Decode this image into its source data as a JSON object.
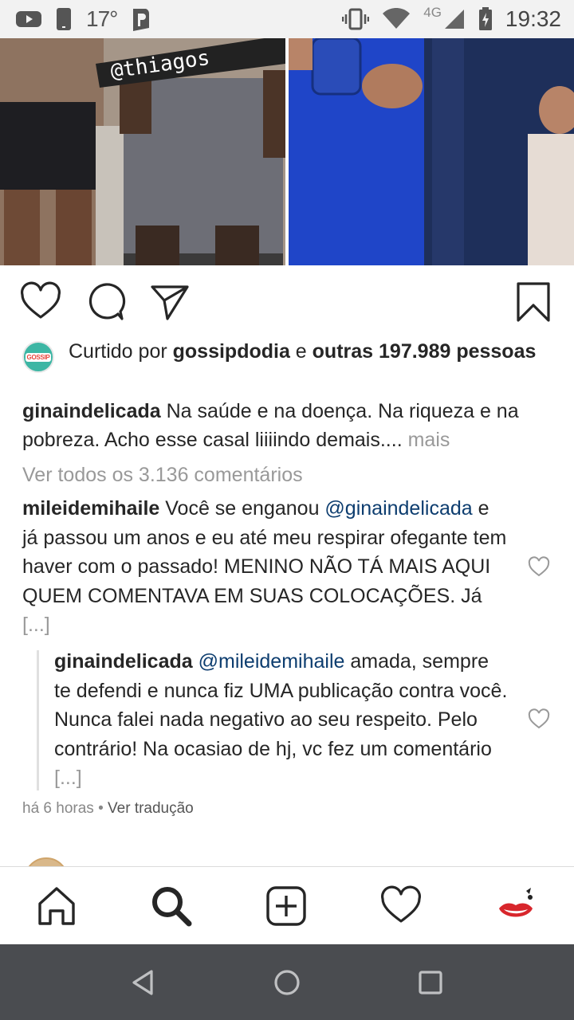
{
  "status_bar": {
    "temperature": "17°",
    "network": "4G",
    "time": "19:32",
    "icons": [
      "youtube-icon",
      "phone-icon",
      "p-app-icon",
      "vibrate-icon",
      "wifi-icon",
      "signal-icon",
      "battery-icon"
    ]
  },
  "post": {
    "images": [
      {
        "name": "photo-left",
        "watermark": "@thiagos"
      },
      {
        "name": "photo-right"
      }
    ],
    "likes": {
      "prefix": "Curtido por ",
      "user": "gossipdodia",
      "middle": " e ",
      "others": "outras 197.989 pessoas",
      "avatar_badge": "GOSSIP"
    },
    "caption": {
      "user": "ginaindelicada",
      "text": " Na saúde e na doença. Na riqueza e na pobreza. Acho esse casal liiiindo demais.... ",
      "more": "mais"
    },
    "view_all_comments": "Ver todos os 3.136 comentários",
    "comments": [
      {
        "user": "mileidemihaile",
        "text_before": " Você se enganou ",
        "mention": "@ginaindelicada",
        "text_after": " e já passou um anos e eu até meu respirar ofegante tem haver com o passado! MENINO NÃO TÁ MAIS AQUI QUEM COMENTAVA EM SUAS COLOCAÇÕES. Já ",
        "ellipsis": "[...]"
      },
      {
        "user": "ginaindelicada",
        "text_before": " ",
        "mention": "@mileidemihaile",
        "text_after": " amada, sempre te defendi e nunca fiz UMA publicação contra você. Nunca falei nada negativo ao seu respeito. Pelo contrário! Na ocasiao de hj, vc fez um comentário ",
        "ellipsis": "[...]"
      }
    ],
    "meta": {
      "time": "há 6 horas",
      "separator": " • ",
      "translate": "Ver tradução"
    }
  },
  "bottom_nav": {
    "items": [
      "home-icon",
      "search-icon",
      "new-post-icon",
      "activity-heart-icon",
      "profile-avatar"
    ]
  },
  "system_nav": {
    "items": [
      "back-icon",
      "home-circle-icon",
      "recents-icon"
    ]
  },
  "colors": {
    "mention": "#0d3d6f",
    "muted": "#999999",
    "text": "#262626",
    "system_nav": "#4a4c50"
  }
}
